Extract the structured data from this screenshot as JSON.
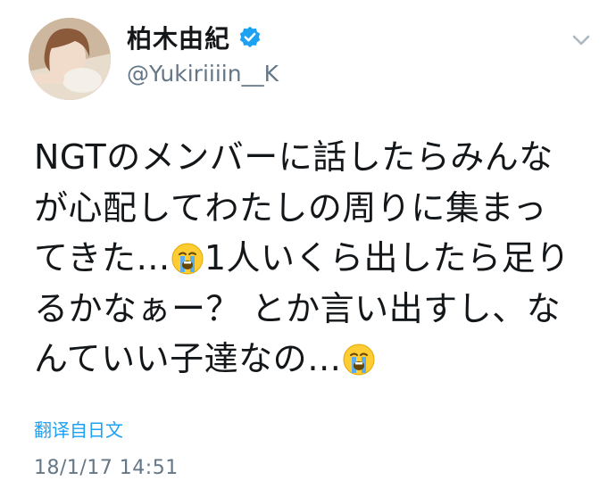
{
  "user": {
    "display_name": "柏木由紀",
    "handle": "@Yukiriiiin__K",
    "verified": true
  },
  "tweet": {
    "lines": [
      "NGTのメンバーに話したらみんな",
      "が心配してわたしの周りに集まっ",
      "てきた…",
      "1人いくら出したら足り",
      "るかなぁー？ とか言い出すし、な",
      "んていい子達なの…"
    ]
  },
  "translate_label": "翻译自日文",
  "timestamp": "18/1/17 14:51",
  "icons": {
    "verified": "verified-badge-icon",
    "menu": "chevron-down-icon",
    "emoji": "loudly-crying-face-emoji"
  },
  "colors": {
    "text": "#14171a",
    "secondary": "#657786",
    "link": "#1da1f2",
    "verified": "#1da1f2"
  }
}
